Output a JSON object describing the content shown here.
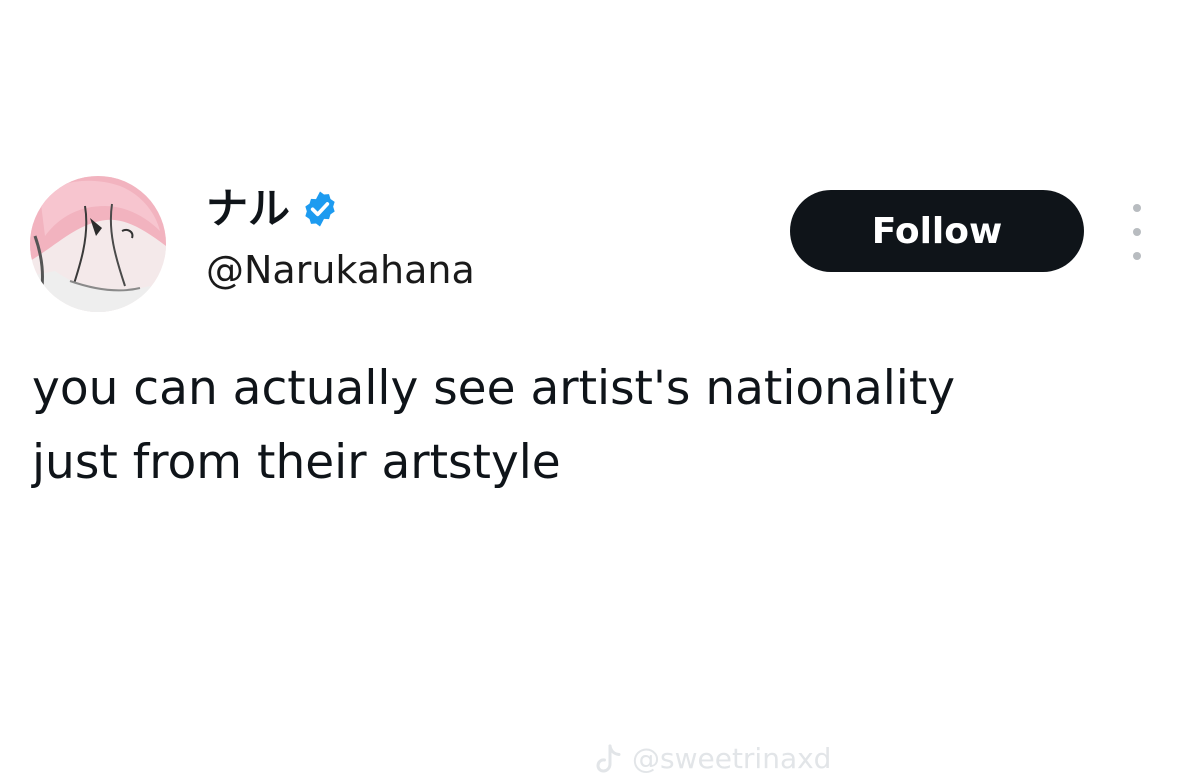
{
  "post": {
    "display_name": "ナル",
    "handle": "@Narukahana",
    "follow_label": "Follow",
    "text": "you can actually see artist's nationality\njust from their artstyle"
  },
  "icons": {
    "avatar": "anime-avatar-image",
    "verified": "verified-badge-icon",
    "more": "more-options-icon",
    "watermark": "tiktok-icon"
  },
  "watermark": {
    "text": "@sweetrinaxd"
  },
  "colors": {
    "background": "#ffffff",
    "text_primary": "#0f1419",
    "follow_button_bg": "#0f1419",
    "follow_button_text": "#ffffff",
    "verified_blue": "#1d9bf0",
    "watermark": "#e1e4e7"
  }
}
